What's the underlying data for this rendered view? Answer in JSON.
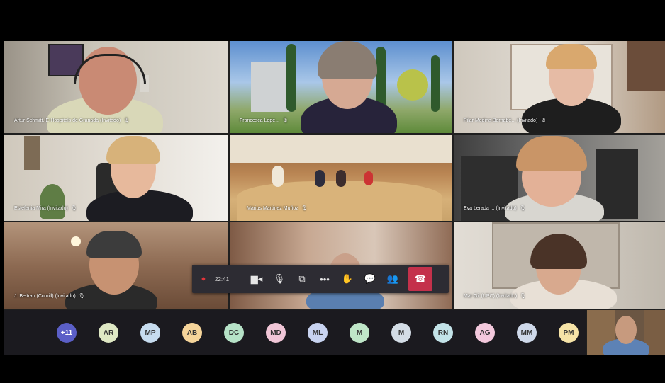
{
  "tiles": [
    {
      "name": "Artur Schmitt, E-Hospitals de Granada (Invitado)"
    },
    {
      "name": "Francesca Lope..."
    },
    {
      "name": "Pilar Medina Bernabé... (Invitado)"
    },
    {
      "name": "Estefania Mira (Invitado)"
    },
    {
      "name": "Màrius Martinez Muñoz"
    },
    {
      "name": "Eva Lerada ... (Invitado)"
    },
    {
      "name": "J. Beltran (Comill) (Invitado)"
    },
    {
      "name": ""
    },
    {
      "name": "Mar Gil (UPC) (Invitado)"
    }
  ],
  "toolbar": {
    "timer": "22:41"
  },
  "participants": [
    {
      "initials": "+11",
      "color": "#5b5fc7"
    },
    {
      "initials": "AR",
      "color": "#dfe8c4"
    },
    {
      "initials": "MP",
      "color": "#c7dcef"
    },
    {
      "initials": "AB",
      "color": "#f5d49a"
    },
    {
      "initials": "DC",
      "color": "#b6e2c7"
    },
    {
      "initials": "MD",
      "color": "#f1c6d7"
    },
    {
      "initials": "ML",
      "color": "#c8d3f0"
    },
    {
      "initials": "M",
      "color": "#bfe6c8"
    },
    {
      "initials": "M",
      "color": "#d4dde6"
    },
    {
      "initials": "RN",
      "color": "#c3e3e8"
    },
    {
      "initials": "AG",
      "color": "#f3c8dc"
    },
    {
      "initials": "MM",
      "color": "#cfd9ea"
    },
    {
      "initials": "PM",
      "color": "#f6e3a7"
    }
  ]
}
